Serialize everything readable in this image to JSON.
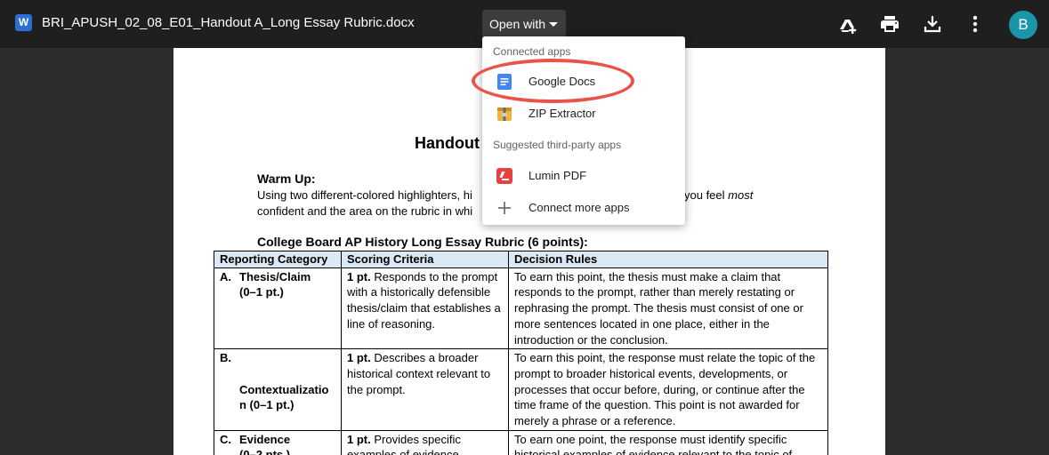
{
  "header": {
    "file_icon_letter": "W",
    "file_title": "BRI_APUSH_02_08_E01_Handout A_Long Essay Rubric.docx",
    "open_with_label": "Open with",
    "icons": [
      "add-to-drive-icon",
      "print-icon",
      "download-icon",
      "more-options-icon"
    ],
    "avatar_letter": "B",
    "colors": {
      "bar": "#1f1f1f",
      "file_icon": "#2b6fd6",
      "avatar": "#1b95a9"
    }
  },
  "menu": {
    "connected_heading": "Connected apps",
    "connected": [
      {
        "label": "Google Docs",
        "icon": "google-docs-icon"
      },
      {
        "label": "ZIP Extractor",
        "icon": "zip-extractor-icon"
      }
    ],
    "suggested_heading": "Suggested third-party apps",
    "suggested": [
      {
        "label": "Lumin PDF",
        "icon": "lumin-pdf-icon"
      },
      {
        "label": "Connect more apps",
        "icon": "plus-icon"
      }
    ],
    "highlight_color": "#e8544a"
  },
  "document": {
    "title": "Handout",
    "warm_up_heading": "Warm Up:",
    "warm_up_line1_left": "Using two different-colored highlighters, hi",
    "warm_up_line1_right_a": "you feel ",
    "warm_up_line1_right_b": "most",
    "warm_up_line2": "confident and the area on the rubric in whi",
    "rubric_heading": "College Board AP History Long Essay Rubric (6 points):",
    "table": {
      "headers": [
        "Reporting Category",
        "Scoring Criteria",
        "Decision Rules"
      ],
      "header_bg": "#dbe8f5",
      "rows": [
        {
          "letter": "A.",
          "category": "Thesis/Claim",
          "points": "(0–1 pt.)",
          "criteria_bold": "1 pt.",
          "criteria": "Responds to the prompt with a historically defensible thesis/claim that establishes a line of reasoning.",
          "rule": "To earn this point, the thesis must make a claim that responds to the prompt, rather than merely restating or rephrasing the prompt. The thesis must consist of one or more sentences located in one place, either in the introduction or the conclusion."
        },
        {
          "letter": "B.",
          "category": "Contextualizatio",
          "points": "n (0–1 pt.)",
          "criteria_bold": "1 pt.",
          "criteria": "Describes a broader historical context relevant to the prompt.",
          "rule": "To earn this point, the response must relate the topic of the prompt to broader historical events, developments, or processes that occur before, during, or continue after the time frame of the question. This point is not awarded for merely a phrase or a reference."
        },
        {
          "letter": "C.",
          "category": "Evidence",
          "points": "(0–2 pts.)",
          "criteria_bold": "1 pt.",
          "criteria": "Provides specific examples of evidence",
          "rule": "To earn one point, the response must identify specific historical examples of evidence relevant to the topic of"
        }
      ]
    }
  }
}
